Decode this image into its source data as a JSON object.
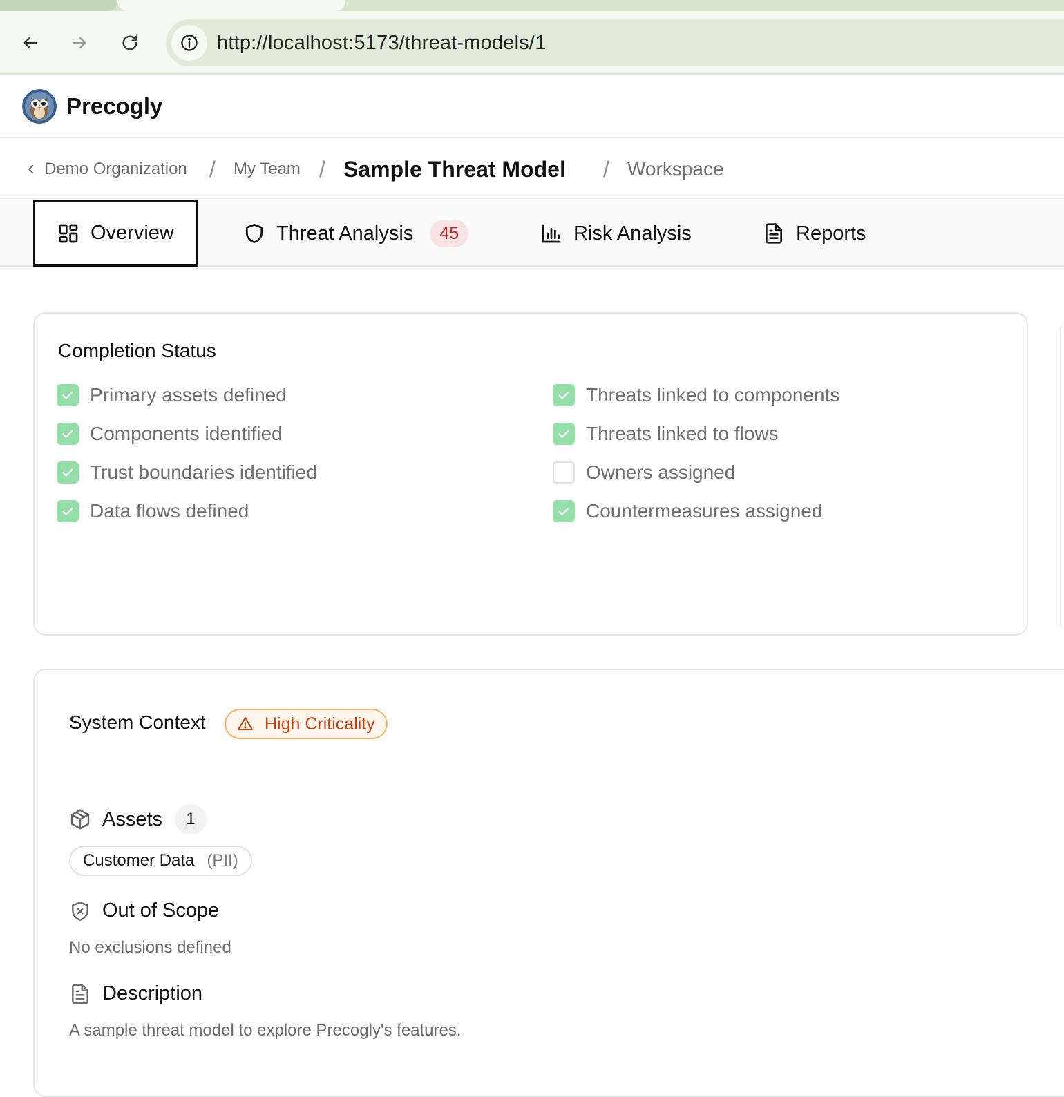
{
  "browser": {
    "url": "http://localhost:5173/threat-models/1",
    "icons": [
      "back-arrow-icon",
      "forward-arrow-icon",
      "reload-icon",
      "site-info-icon"
    ]
  },
  "header": {
    "brand": "Precogly",
    "logo_icon": "owl-logo-icon"
  },
  "breadcrumb": {
    "separator": "/",
    "organization": "Demo Organization",
    "team": "My Team",
    "title": "Sample Threat Model",
    "workspace": "Workspace"
  },
  "tabs": {
    "overview": {
      "label": "Overview",
      "icon": "layout-grid-icon"
    },
    "threat": {
      "label": "Threat Analysis",
      "icon": "shield-icon",
      "count": "45"
    },
    "risk": {
      "label": "Risk Analysis",
      "icon": "bar-chart-icon"
    },
    "reports": {
      "label": "Reports",
      "icon": "document-icon"
    }
  },
  "completion": {
    "title": "Completion Status",
    "items": [
      {
        "label": "Primary assets defined",
        "checked": true
      },
      {
        "label": "Components identified",
        "checked": true
      },
      {
        "label": "Trust boundaries identified",
        "checked": true
      },
      {
        "label": "Data flows defined",
        "checked": true
      },
      {
        "label": "Threats linked to components",
        "checked": true
      },
      {
        "label": "Threats linked to flows",
        "checked": true
      },
      {
        "label": "Owners assigned",
        "checked": false
      },
      {
        "label": "Countermeasures assigned",
        "checked": true
      }
    ]
  },
  "context": {
    "title": "System Context",
    "criticality": "High Criticality",
    "assets_title": "Assets",
    "assets_count": "1",
    "asset_name": "Customer Data",
    "asset_tag": "(PII)",
    "scope_title": "Out of Scope",
    "scope_text": "No exclusions defined",
    "description_title": "Description",
    "description_text": "A sample threat model to explore Precogly's features."
  },
  "colors": {
    "check_green": "#94dfa9",
    "badge_red_bg": "#fbe3e3",
    "badge_red_text": "#b42323",
    "criticality_orange": "#c2410c",
    "chrome_green": "#e1ebda"
  }
}
